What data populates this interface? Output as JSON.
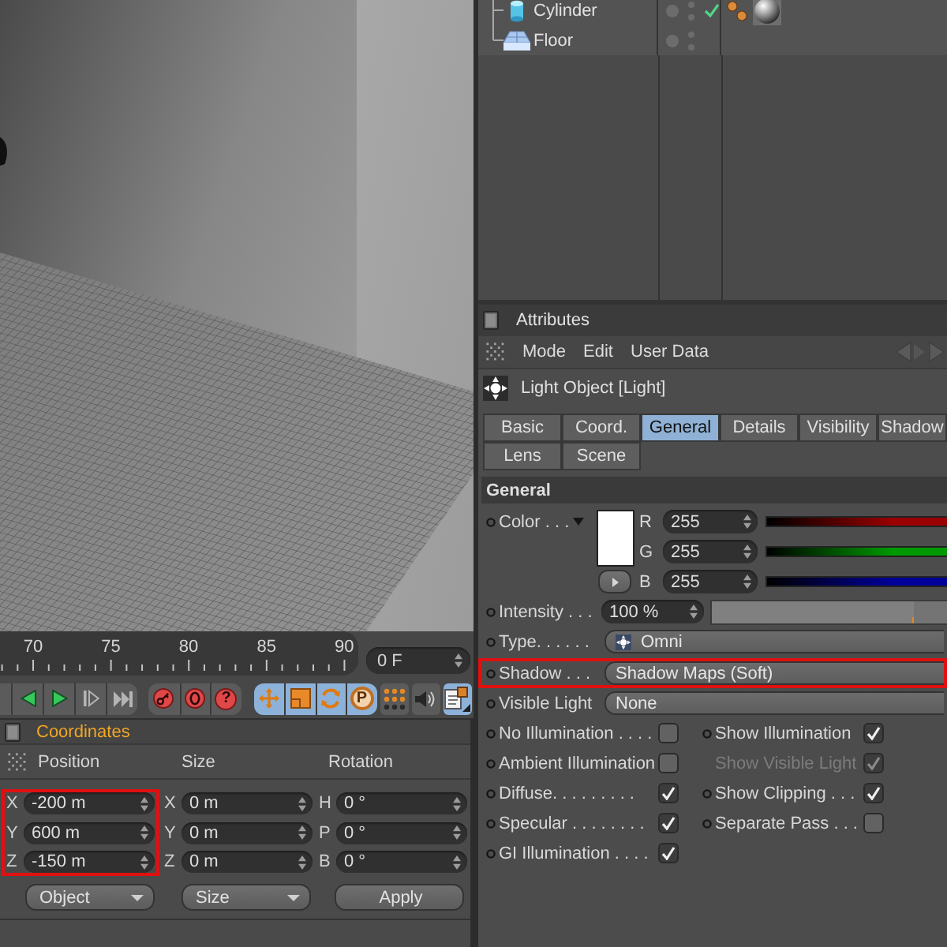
{
  "object_manager": {
    "objects": [
      {
        "name": "Cylinder",
        "kind": "cylinder",
        "checked": true,
        "tags": [
          {
            "kind": "phong"
          },
          {
            "kind": "material"
          }
        ]
      },
      {
        "name": "Floor",
        "kind": "floor",
        "checked": false
      }
    ]
  },
  "timeline": {
    "labels": [
      "70",
      "75",
      "80",
      "85",
      "90"
    ],
    "frame": "0 F"
  },
  "toolbar": {
    "transport": [
      {
        "kind": "previous"
      },
      {
        "kind": "play"
      },
      {
        "kind": "next"
      },
      {
        "kind": "end"
      }
    ],
    "record_buttons": [
      {
        "kind": "record"
      },
      {
        "kind": "autokey"
      },
      {
        "kind": "help",
        "glyph": "?"
      }
    ],
    "key_tracks": [
      {
        "kind": "move",
        "on": true
      },
      {
        "kind": "scale",
        "on": true
      },
      {
        "kind": "rotate",
        "on": true
      },
      {
        "kind": "parameter",
        "on": true,
        "glyph": "P"
      }
    ],
    "tools": [
      {
        "kind": "points",
        "on": false
      },
      {
        "kind": "sound",
        "on": false
      },
      {
        "kind": "scheme",
        "on": true
      }
    ]
  },
  "coordinates": {
    "title": "Coordinates",
    "columns": [
      {
        "heading": "Position",
        "highlighted": true,
        "fields": [
          {
            "axis": "X",
            "value": "-200 m"
          },
          {
            "axis": "Y",
            "value": "600 m"
          },
          {
            "axis": "Z",
            "value": "-150 m"
          }
        ]
      },
      {
        "heading": "Size",
        "highlighted": false,
        "fields": [
          {
            "axis": "X",
            "value": "0 m"
          },
          {
            "axis": "Y",
            "value": "0 m"
          },
          {
            "axis": "Z",
            "value": "0 m"
          }
        ]
      },
      {
        "heading": "Rotation",
        "highlighted": false,
        "fields": [
          {
            "axis": "H",
            "value": "0 °"
          },
          {
            "axis": "P",
            "value": "0 °"
          },
          {
            "axis": "B",
            "value": "0 °"
          }
        ]
      }
    ],
    "buttons": [
      {
        "label": "Object",
        "kind": "dropdown"
      },
      {
        "label": "Size",
        "kind": "dropdown"
      },
      {
        "label": "Apply",
        "kind": "button"
      }
    ]
  },
  "attributes": {
    "title": "Attributes",
    "menu": [
      "Mode",
      "Edit",
      "User Data"
    ],
    "object_title": "Light Object [Light]",
    "tabs": [
      {
        "label": "Basic",
        "selected": false
      },
      {
        "label": "Coord.",
        "selected": false
      },
      {
        "label": "General",
        "selected": true
      },
      {
        "label": "Details",
        "selected": false
      },
      {
        "label": "Visibility",
        "selected": false
      },
      {
        "label": "Shadow",
        "selected": false
      },
      {
        "label": "Lens",
        "selected": false
      },
      {
        "label": "Scene",
        "selected": false
      }
    ],
    "section": "General",
    "color": {
      "label": "Color . . .",
      "channels": [
        {
          "label": "R",
          "value": "255",
          "color": "#9a0000"
        },
        {
          "label": "G",
          "value": "255",
          "color": "#009a00"
        },
        {
          "label": "B",
          "value": "255",
          "color": "#00009a"
        }
      ]
    },
    "intensity": {
      "label": "Intensity . . .",
      "value": "100 %",
      "level": 0.86
    },
    "dropdowns": [
      {
        "kind": "light_type",
        "label": "Type. . . . . .",
        "value": "Omni",
        "highlighted": false
      },
      {
        "kind": "shadow",
        "label": "Shadow . . .",
        "value": "Shadow Maps (Soft)",
        "highlighted": true
      },
      {
        "kind": "visible_light",
        "label": "Visible Light",
        "value": "None",
        "highlighted": false
      }
    ],
    "options": [
      {
        "label": "No Illumination . . . .",
        "checked": false,
        "disabled": false
      },
      {
        "label": "Show Illumination",
        "checked": true,
        "disabled": false
      },
      {
        "label": "Ambient Illumination",
        "checked": false,
        "disabled": false
      },
      {
        "label": "Show Visible Light",
        "checked": true,
        "disabled": true
      },
      {
        "label": "Diffuse. . . . . . . . .",
        "checked": true,
        "disabled": false
      },
      {
        "label": "Show Clipping . . .",
        "checked": true,
        "disabled": false
      },
      {
        "label": "Specular . . . . . . . .",
        "checked": true,
        "disabled": false
      },
      {
        "label": "Separate Pass . . .",
        "checked": false,
        "disabled": false
      },
      {
        "label": "GI Illumination . . . .",
        "checked": true,
        "disabled": false
      }
    ]
  }
}
